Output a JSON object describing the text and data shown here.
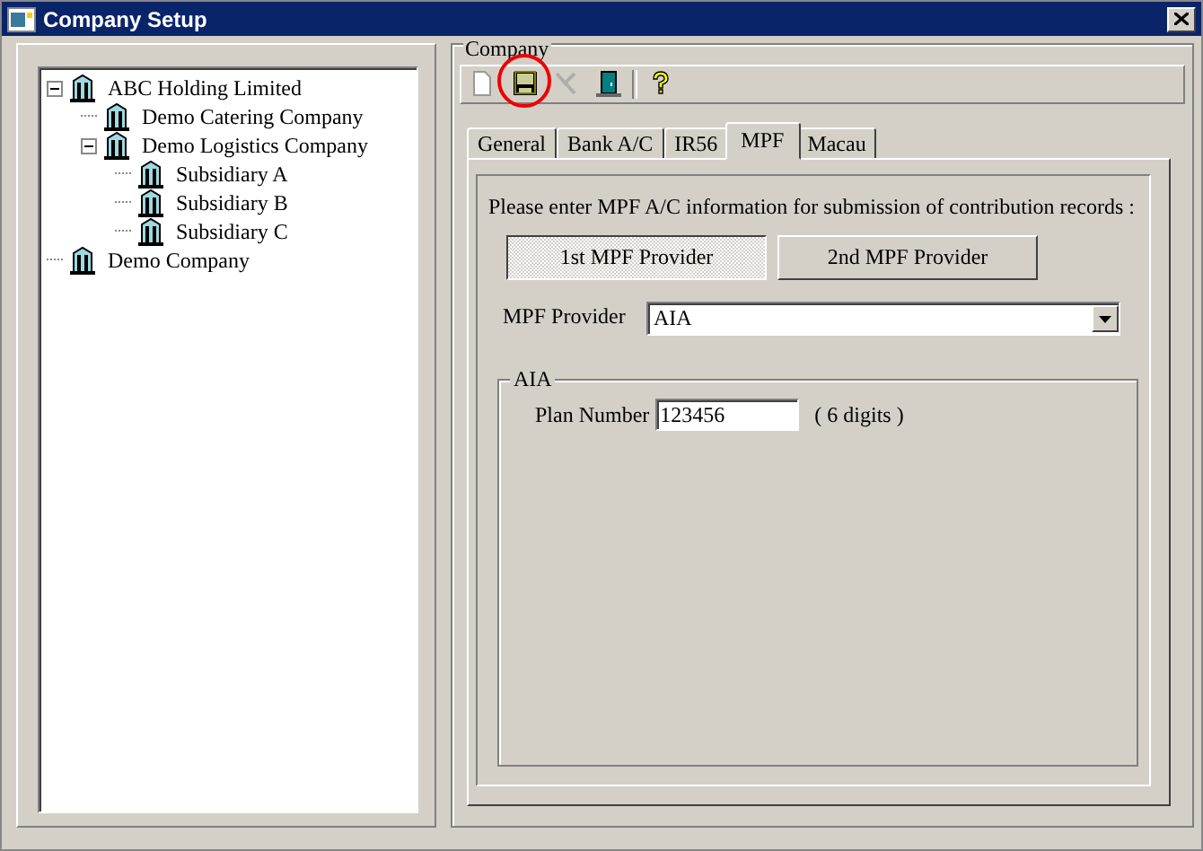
{
  "window": {
    "title": "Company Setup"
  },
  "tree": [
    {
      "label": "ABC Holding Limited",
      "expanded": true,
      "children": [
        {
          "label": "Demo Catering Company"
        },
        {
          "label": "Demo Logistics Company",
          "expanded": true,
          "children": [
            {
              "label": "Subsidiary A"
            },
            {
              "label": "Subsidiary B"
            },
            {
              "label": "Subsidiary C"
            }
          ]
        }
      ]
    },
    {
      "label": "Demo Company"
    }
  ],
  "group_title": "Company",
  "toolbar": [
    {
      "kind": "new",
      "disabled": false
    },
    {
      "kind": "save",
      "disabled": false,
      "highlighted": true
    },
    {
      "kind": "delete",
      "disabled": true
    },
    {
      "kind": "exit",
      "disabled": false
    },
    {
      "kind": "sep"
    },
    {
      "kind": "help",
      "disabled": false
    }
  ],
  "tabs": [
    {
      "label": "General",
      "selected": false
    },
    {
      "label": "Bank A/C",
      "selected": false
    },
    {
      "label": "IR56",
      "selected": false
    },
    {
      "label": "MPF",
      "selected": true
    },
    {
      "label": "Macau",
      "selected": false
    }
  ],
  "mpf": {
    "instruction": "Please enter MPF A/C information for submission of contribution records :",
    "providers": [
      {
        "label": "1st MPF Provider",
        "selected": true
      },
      {
        "label": "2nd MPF Provider",
        "selected": false
      }
    ],
    "provider_label": "MPF Provider",
    "provider_value": "AIA",
    "section_title": "AIA",
    "plan_label": "Plan Number",
    "plan_value": "123456",
    "plan_hint": "( 6 digits )"
  }
}
